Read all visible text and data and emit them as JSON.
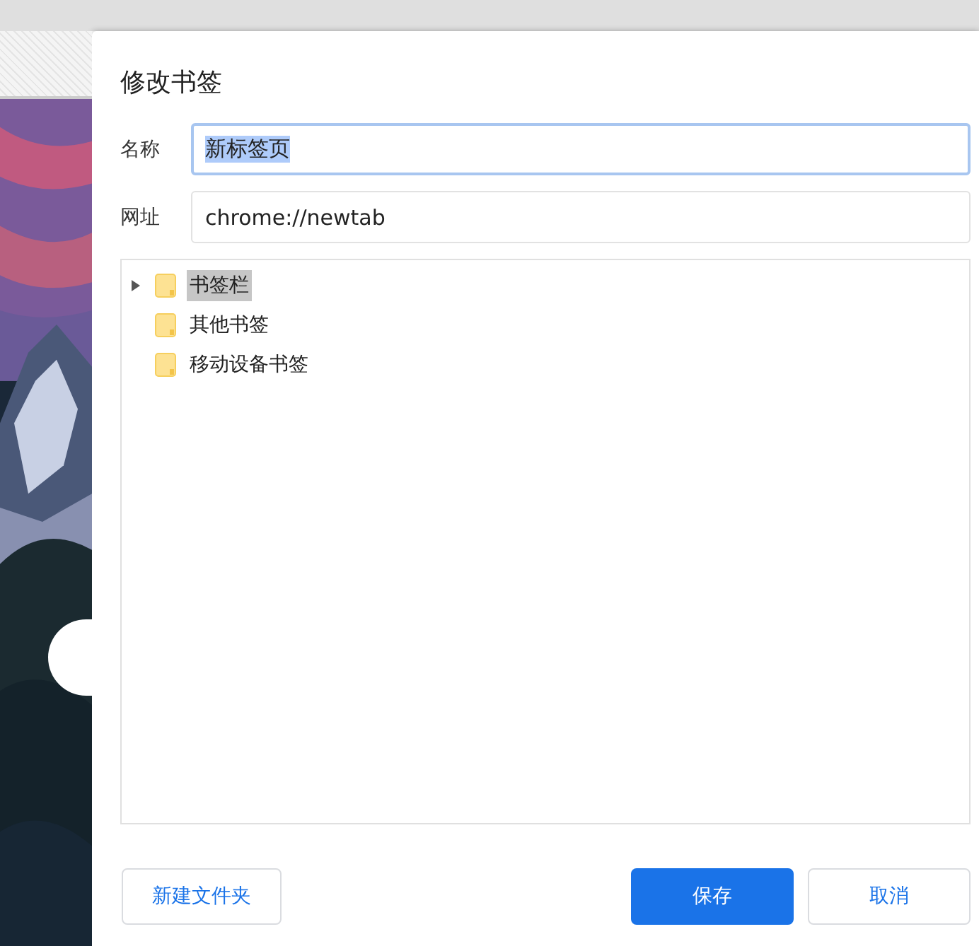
{
  "dialog": {
    "title": "修改书签",
    "name_field": {
      "label": "名称",
      "value": "新标签页",
      "focused": true,
      "text_selected": true
    },
    "url_field": {
      "label": "网址",
      "value": "chrome://newtab",
      "focused": false,
      "text_selected": false
    },
    "folders": [
      {
        "label": "书签栏",
        "selected": true,
        "expandable": true
      },
      {
        "label": "其他书签",
        "selected": false,
        "expandable": false
      },
      {
        "label": "移动设备书签",
        "selected": false,
        "expandable": false
      }
    ],
    "buttons": [
      {
        "label": "新建文件夹",
        "kind": "secondary"
      },
      {
        "label": "保存",
        "kind": "primary"
      },
      {
        "label": "取消",
        "kind": "secondary"
      }
    ]
  }
}
